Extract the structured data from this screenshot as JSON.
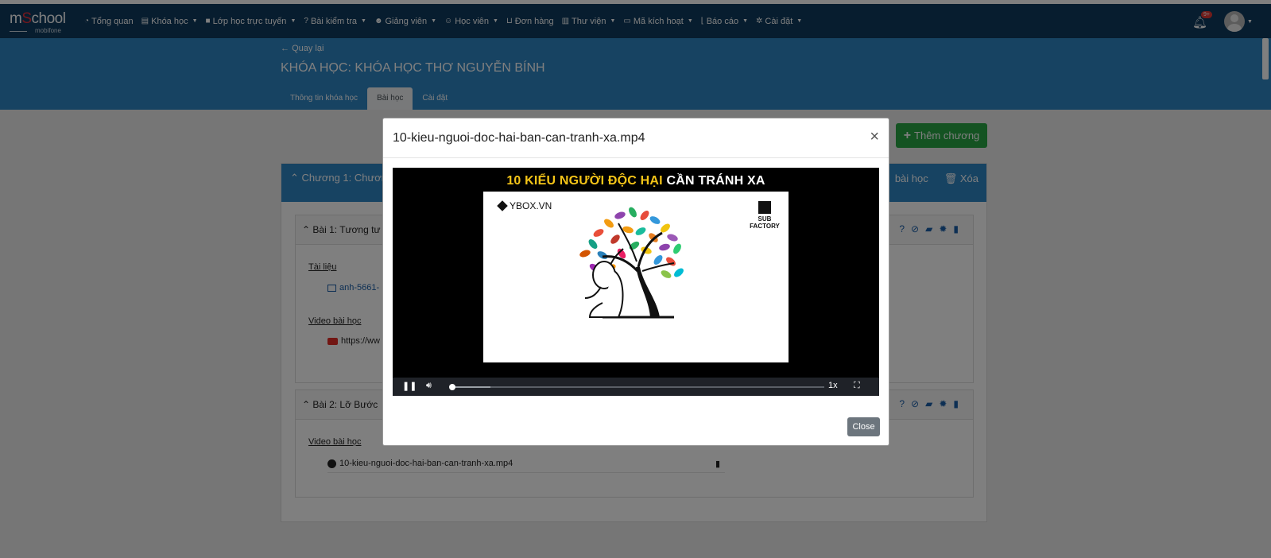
{
  "nav": {
    "brand_prefix": "m",
    "brand_o": "S",
    "brand_suffix": "chool",
    "brand_sub": "mobifone",
    "items": [
      {
        "label": "Tổng quan",
        "icon": "dashboard-icon",
        "dropdown": false
      },
      {
        "label": "Khóa học",
        "icon": "book-icon",
        "dropdown": true
      },
      {
        "label": "Lớp học trực tuyến",
        "icon": "video-camera-icon",
        "dropdown": true
      },
      {
        "label": "Bài kiểm tra",
        "icon": "question-icon",
        "dropdown": true
      },
      {
        "label": "Giảng viên",
        "icon": "users-icon",
        "dropdown": true
      },
      {
        "label": "Học viên",
        "icon": "user-icon",
        "dropdown": true
      },
      {
        "label": "Đơn hàng",
        "icon": "cart-icon",
        "dropdown": false
      },
      {
        "label": "Thư viện",
        "icon": "library-icon",
        "dropdown": true
      },
      {
        "label": "Mã kích hoạt",
        "icon": "card-icon",
        "dropdown": true
      },
      {
        "label": "Báo cáo",
        "icon": "chart-icon",
        "dropdown": true
      },
      {
        "label": "Cài đặt",
        "icon": "gears-icon",
        "dropdown": true
      }
    ],
    "notification_badge": "9+"
  },
  "header": {
    "back_label": "Quay lại",
    "title": "KHÓA HỌC: KHÓA HỌC THƠ NGUYỄN BÍNH",
    "tabs": [
      {
        "label": "Thông tin khóa học",
        "active": false
      },
      {
        "label": "Bài học",
        "active": true
      },
      {
        "label": "Cài đặt",
        "active": false
      }
    ]
  },
  "content": {
    "add_chapter_label": "Thêm chương",
    "chapter": {
      "title": "Chương 1: Chươn",
      "add_lesson_label": "bài học",
      "delete_label": "Xóa"
    },
    "lessons": [
      {
        "title": "Bài 1: Tương tư",
        "sections": [
          {
            "label": "Tài liệu",
            "item": "anh-5661-"
          },
          {
            "label": "Video bài học",
            "item": "https://ww"
          }
        ]
      },
      {
        "title": "Bài 2: Lỡ Bước",
        "sections": [
          {
            "label": "Video bài học",
            "item": "10-kieu-nguoi-doc-hai-ban-can-tranh-xa.mp4"
          }
        ]
      }
    ]
  },
  "modal": {
    "title": "10-kieu-nguoi-doc-hai-ban-can-tranh-xa.mp4",
    "video": {
      "headline_yellow": "10 KIỂU NGƯỜI ĐỘC HẠI",
      "headline_white": "CẦN TRÁNH XA",
      "watermark_left": "YBOX.VN",
      "watermark_right": "SUB FACTORY",
      "speed": "1x",
      "progress": 0.0
    },
    "close_label": "Close"
  },
  "colors": {
    "navbar": "#0f3b5f",
    "header": "#2f86c5",
    "success": "#28a745",
    "icon_blue": "#1a5ea8",
    "close_button": "#6c757d"
  }
}
